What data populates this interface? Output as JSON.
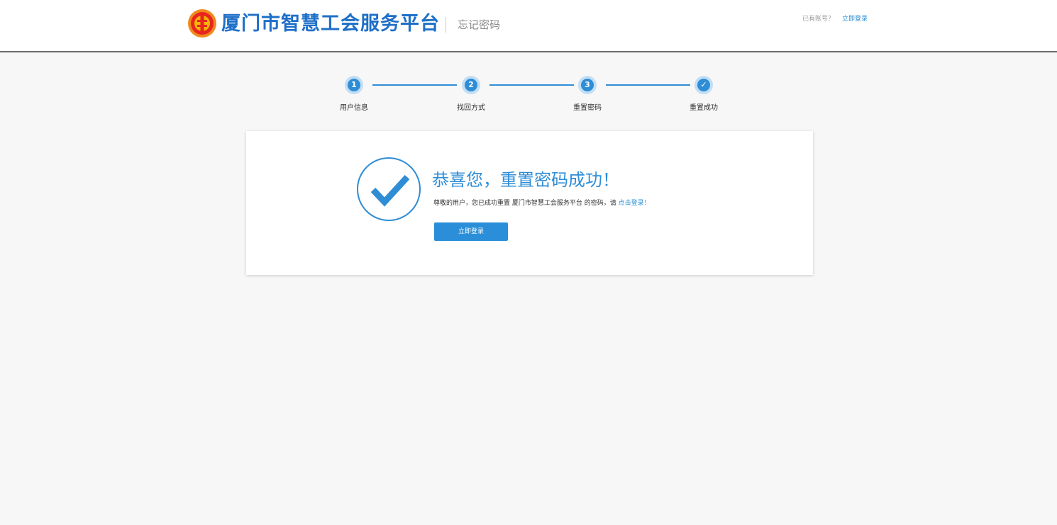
{
  "header": {
    "site_title": "厦门市智慧工会服务平台",
    "page_subtitle": "忘记密码",
    "account_prompt": "已有账号？",
    "login_link": "立即登录",
    "logo_icon": "trade-union-emblem-icon"
  },
  "steps": [
    {
      "marker": "1",
      "label": "用户信息",
      "icon": "step-number-icon"
    },
    {
      "marker": "2",
      "label": "找回方式",
      "icon": "step-number-icon"
    },
    {
      "marker": "3",
      "label": "重置密码",
      "icon": "step-number-icon"
    },
    {
      "marker": "✓",
      "label": "重置成功",
      "icon": "check-icon"
    }
  ],
  "result": {
    "icon": "success-check-circle-icon",
    "title": "恭喜您，重置密码成功！",
    "message_prefix": "尊敬的用户，您已成功重置 ",
    "platform_name": "厦门市智慧工会服务平台",
    "message_middle": " 的密码，请 ",
    "message_link": "点击登录！",
    "button_label": "立即登录"
  },
  "colors": {
    "brand_blue": "#1e6fc8",
    "accent_blue": "#2f8dd6",
    "link_blue": "#2a8fd8",
    "logo_orange": "#f08a1c",
    "logo_red": "#e8251f"
  }
}
